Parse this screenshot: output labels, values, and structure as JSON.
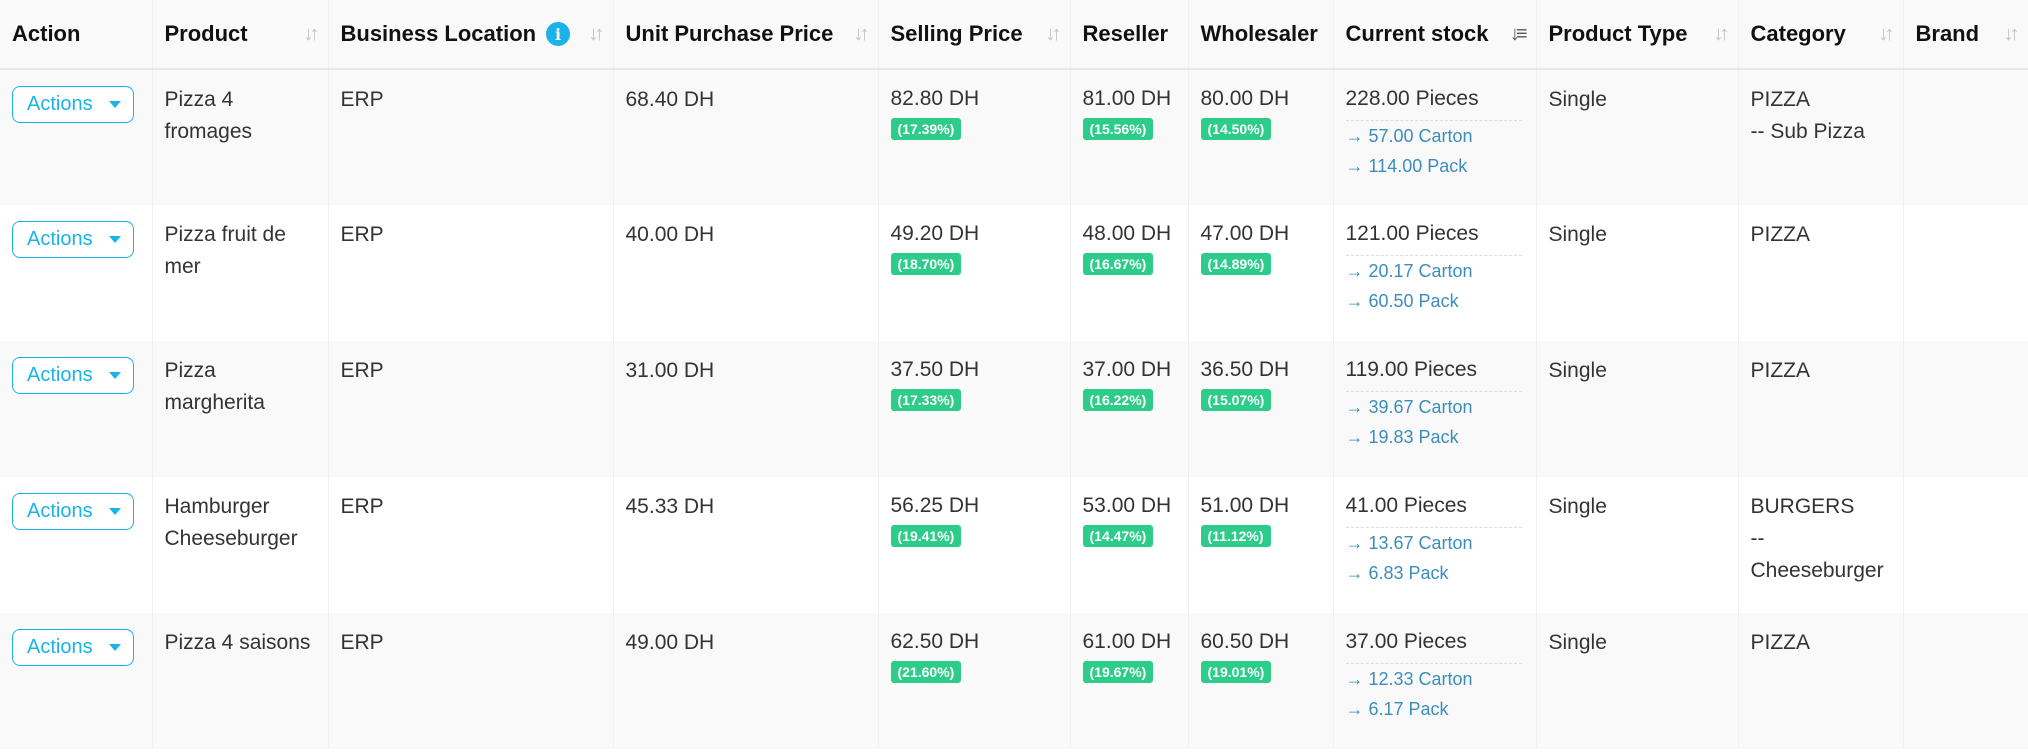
{
  "headers": {
    "action": "Action",
    "product": "Product",
    "business_location": "Business Location",
    "unit_purchase_price": "Unit Purchase Price",
    "selling_price": "Selling Price",
    "reseller": "Reseller",
    "wholesaler": "Wholesaler",
    "current_stock": "Current stock",
    "product_type": "Product Type",
    "category": "Category",
    "brand": "Brand"
  },
  "actions_label": "Actions",
  "rows": [
    {
      "product_line1": "Pizza 4",
      "product_line2": "fromages",
      "location": "ERP",
      "purchase": "68.40 DH",
      "selling": "82.80 DH",
      "selling_pct": "(17.39%)",
      "reseller": "81.00 DH",
      "reseller_pct": "(15.56%)",
      "wholesaler": "80.00 DH",
      "wholesaler_pct": "(14.50%)",
      "stock": "228.00 Pieces",
      "stock_sub1": "→ 57.00 Carton",
      "stock_sub2": "→ 114.00 Pack",
      "type": "Single",
      "category_line1": "PIZZA",
      "category_line2": "-- Sub Pizza",
      "category_line3": ""
    },
    {
      "product_line1": "Pizza fruit de",
      "product_line2": "mer",
      "location": "ERP",
      "purchase": "40.00 DH",
      "selling": "49.20 DH",
      "selling_pct": "(18.70%)",
      "reseller": "48.00 DH",
      "reseller_pct": "(16.67%)",
      "wholesaler": "47.00 DH",
      "wholesaler_pct": "(14.89%)",
      "stock": "121.00 Pieces",
      "stock_sub1": "→ 20.17 Carton",
      "stock_sub2": "→ 60.50 Pack",
      "type": "Single",
      "category_line1": "PIZZA",
      "category_line2": "",
      "category_line3": ""
    },
    {
      "product_line1": "Pizza",
      "product_line2": "margherita",
      "location": "ERP",
      "purchase": "31.00 DH",
      "selling": "37.50 DH",
      "selling_pct": "(17.33%)",
      "reseller": "37.00 DH",
      "reseller_pct": "(16.22%)",
      "wholesaler": "36.50 DH",
      "wholesaler_pct": "(15.07%)",
      "stock": "119.00 Pieces",
      "stock_sub1": "→ 39.67 Carton",
      "stock_sub2": "→ 19.83 Pack",
      "type": "Single",
      "category_line1": "PIZZA",
      "category_line2": "",
      "category_line3": ""
    },
    {
      "product_line1": "Hamburger",
      "product_line2": "Cheeseburger",
      "location": "ERP",
      "purchase": "45.33 DH",
      "selling": "56.25 DH",
      "selling_pct": "(19.41%)",
      "reseller": "53.00 DH",
      "reseller_pct": "(14.47%)",
      "wholesaler": "51.00 DH",
      "wholesaler_pct": "(11.12%)",
      "stock": "41.00 Pieces",
      "stock_sub1": "→ 13.67 Carton",
      "stock_sub2": "→ 6.83 Pack",
      "type": "Single",
      "category_line1": "BURGERS",
      "category_line2": "--",
      "category_line3": "Cheeseburger"
    },
    {
      "product_line1": "Pizza 4 saisons",
      "product_line2": "",
      "location": "ERP",
      "purchase": "49.00 DH",
      "selling": "62.50 DH",
      "selling_pct": "(21.60%)",
      "reseller": "61.00 DH",
      "reseller_pct": "(19.67%)",
      "wholesaler": "60.50 DH",
      "wholesaler_pct": "(19.01%)",
      "stock": "37.00 Pieces",
      "stock_sub1": "→ 12.33 Carton",
      "stock_sub2": "→ 6.17 Pack",
      "type": "Single",
      "category_line1": "PIZZA",
      "category_line2": "",
      "category_line3": ""
    }
  ]
}
